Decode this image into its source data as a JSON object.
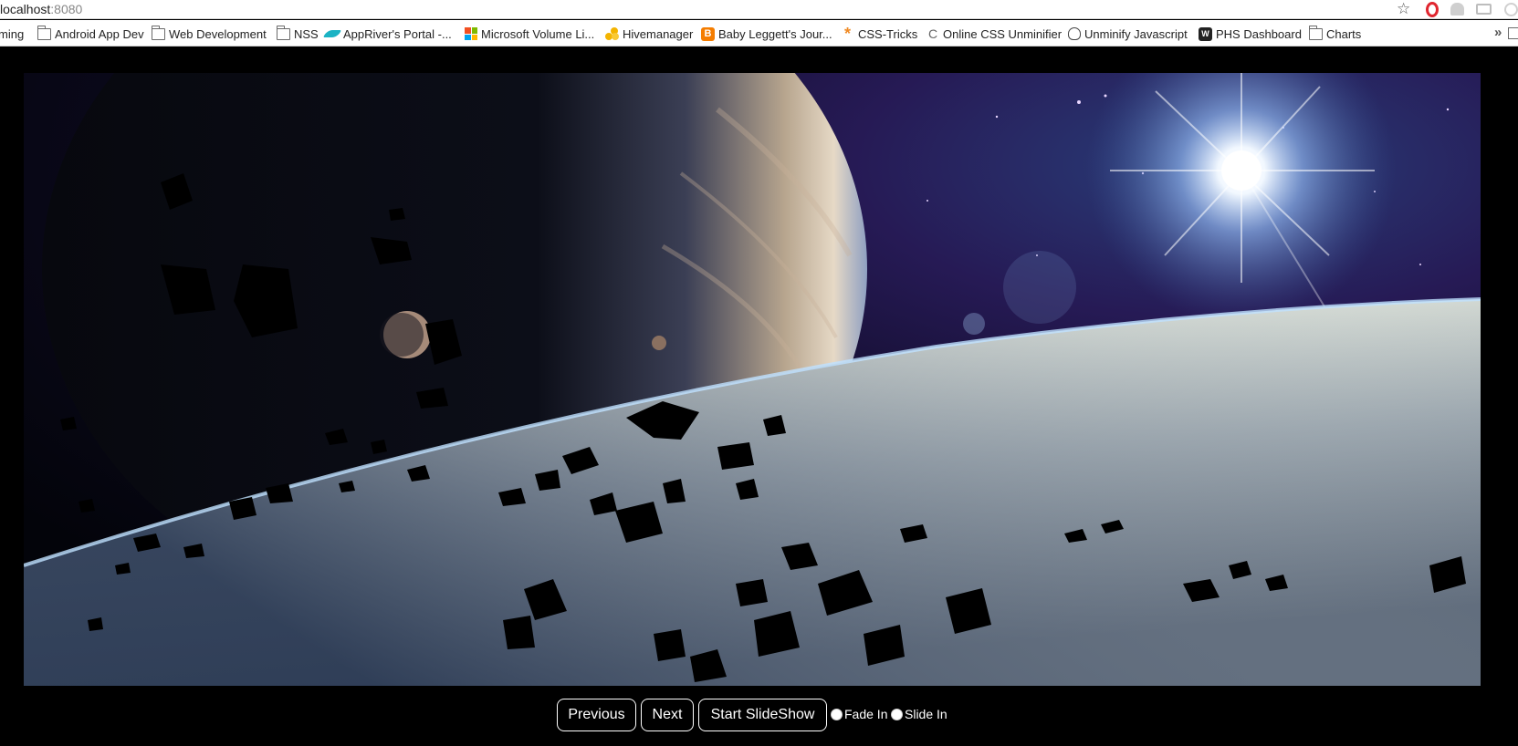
{
  "browser": {
    "url_host": "localhost",
    "url_port": ":8080",
    "bookmarks": [
      {
        "label": "ming",
        "icon": "folder-icon"
      },
      {
        "label": "Android App Dev",
        "icon": "folder-icon"
      },
      {
        "label": "Web Development",
        "icon": "folder-icon"
      },
      {
        "label": "NSS",
        "icon": "folder-icon"
      },
      {
        "label": "AppRiver's Portal -...",
        "icon": "appriver-icon"
      },
      {
        "label": "Microsoft Volume Li...",
        "icon": "microsoft-icon"
      },
      {
        "label": "Hivemanager",
        "icon": "hivemanager-icon"
      },
      {
        "label": "Baby Leggett's Jour...",
        "icon": "blogger-icon"
      },
      {
        "label": "CSS-Tricks",
        "icon": "css-tricks-icon"
      },
      {
        "label": "Online CSS Unminifier",
        "icon": "unminifier-icon"
      },
      {
        "label": "Unminify Javascript",
        "icon": "owl-icon"
      },
      {
        "label": "PHS Dashboard",
        "icon": "phs-icon"
      },
      {
        "label": "Charts",
        "icon": "folder-icon"
      }
    ]
  },
  "slideshow": {
    "image_alt": "Space scene with gas giant, asteroid field and bright star over a planet horizon",
    "prev_label": "Previous",
    "next_label": "Next",
    "start_label": "Start SlideShow",
    "fade_label": "Fade In",
    "slide_label": "Slide In",
    "colors": {
      "background": "#000000",
      "button_border": "#ffffff"
    }
  }
}
